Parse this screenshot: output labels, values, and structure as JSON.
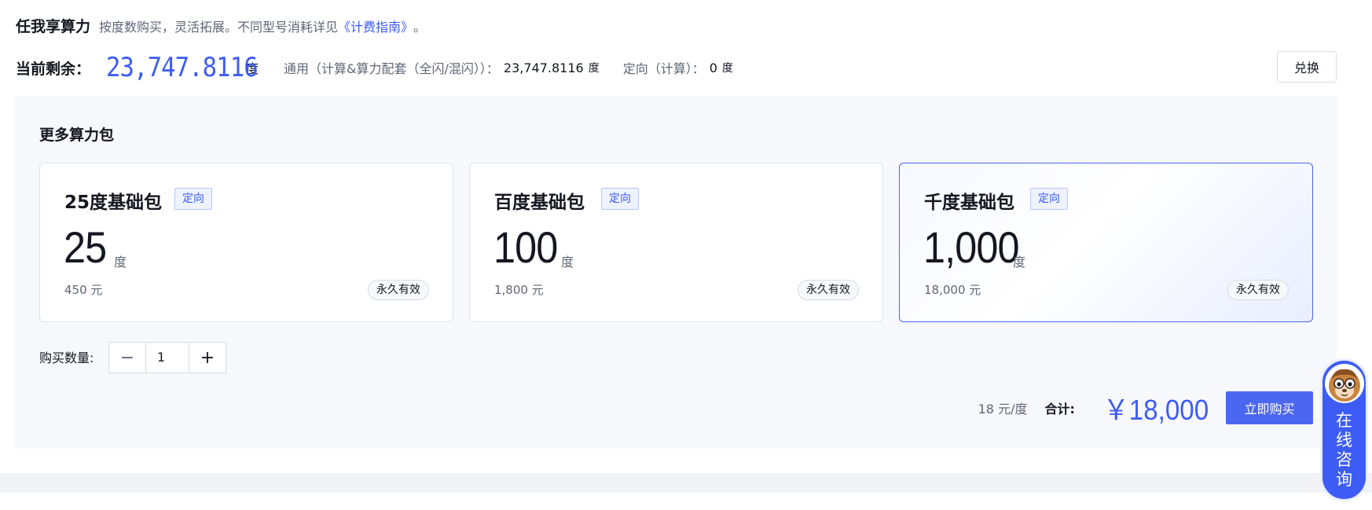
{
  "header": {
    "title": "任我享算力",
    "description": "按度数购买，灵活拓展。不同型号消耗详见",
    "guide_link": "《计费指南》",
    "tail": "。"
  },
  "balance": {
    "label": "当前剩余：",
    "value": "23,747.8116",
    "unit": "度",
    "general_label": "通用（计算&算力配套（全闪/混闪））：",
    "general_value": "23,747.8116",
    "general_unit": "度",
    "directed_label": "定向（计算）：",
    "directed_value": "0",
    "directed_unit": "度",
    "exchange_label": "兑换"
  },
  "packages": {
    "title": "更多算力包",
    "items": [
      {
        "name": "25度基础包",
        "tag": "定向",
        "amount": "25",
        "unit": "度",
        "price": "450 元",
        "badge": "永久有效",
        "selected": false
      },
      {
        "name": "百度基础包",
        "tag": "定向",
        "amount": "100",
        "unit": "度",
        "price": "1,800 元",
        "badge": "永久有效",
        "selected": false
      },
      {
        "name": "千度基础包",
        "tag": "定向",
        "amount": "1,000",
        "unit": "度",
        "price": "18,000 元",
        "badge": "永久有效",
        "selected": true
      }
    ]
  },
  "quantity": {
    "label": "购买数量:",
    "value": "1",
    "minus": "−",
    "plus": "+"
  },
  "total": {
    "unit_price": "18 元/度",
    "label": "合计:",
    "value": "￥18,000",
    "buy_label": "立即购买"
  },
  "consult": {
    "label": "在线咨询"
  },
  "colors": {
    "accent": "#3d5cf5",
    "button": "#4b67f2",
    "panel_bg": "#f7f8fb"
  }
}
